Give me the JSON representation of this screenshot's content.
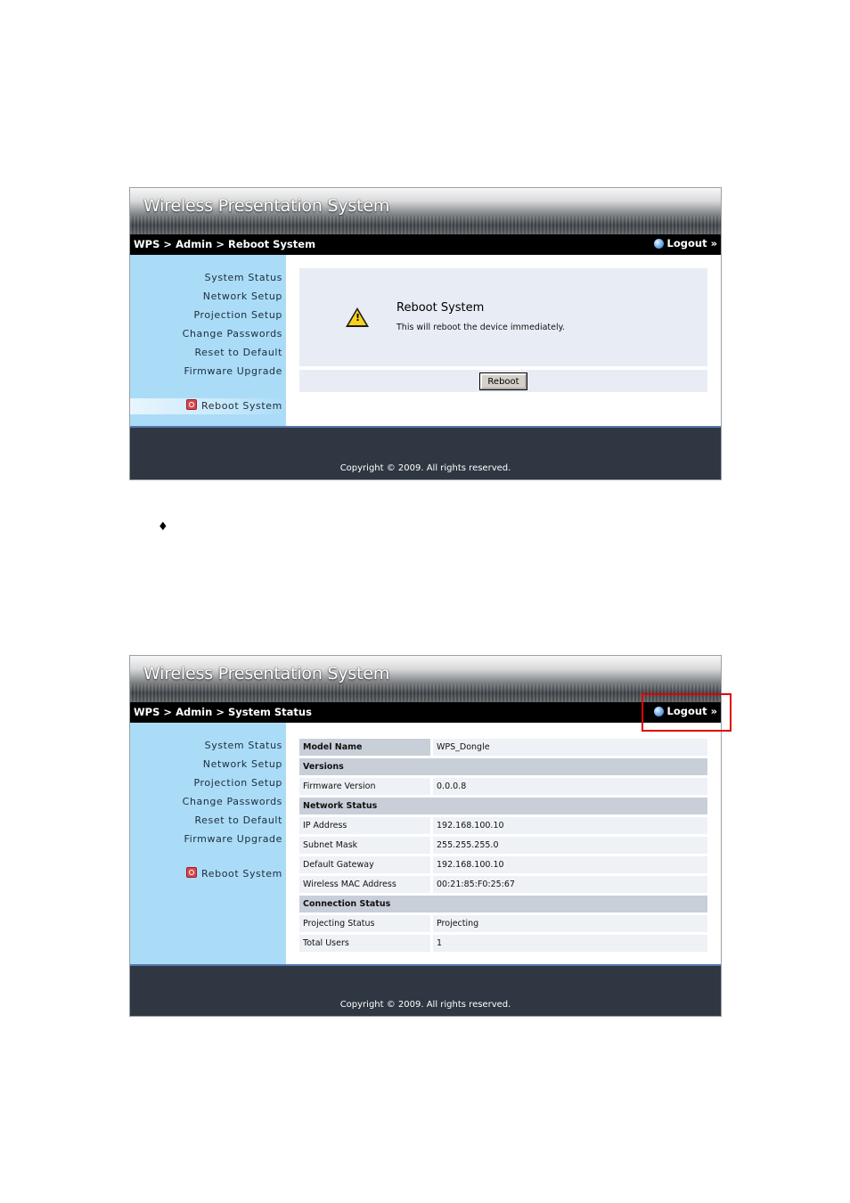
{
  "app": {
    "title": "Wireless Presentation System",
    "logout_label": "Logout »",
    "copyright": "Copyright © 2009. All rights reserved."
  },
  "menu": [
    "System Status",
    "Network Setup",
    "Projection Setup",
    "Change Passwords",
    "Reset to Default",
    "Firmware Upgrade"
  ],
  "reboot_menu_label": "Reboot System",
  "screen1": {
    "breadcrumb": [
      "WPS",
      "Admin",
      "Reboot System"
    ],
    "panel_title": "Reboot System",
    "panel_desc": "This will reboot the device immediately.",
    "button_label": "Reboot"
  },
  "bullet": "♦",
  "screen2": {
    "breadcrumb": [
      "WPS",
      "Admin",
      "System Status"
    ],
    "rows": [
      {
        "type": "model",
        "key": "Model Name",
        "value": "WPS_Dongle"
      },
      {
        "type": "section",
        "key": "Versions"
      },
      {
        "type": "row",
        "key": "Firmware Version",
        "value": "0.0.0.8"
      },
      {
        "type": "section",
        "key": "Network Status"
      },
      {
        "type": "row",
        "key": "IP Address",
        "value": "192.168.100.10"
      },
      {
        "type": "row",
        "key": "Subnet Mask",
        "value": "255.255.255.0"
      },
      {
        "type": "row",
        "key": "Default Gateway",
        "value": "192.168.100.10"
      },
      {
        "type": "row",
        "key": "Wireless MAC Address",
        "value": "00:21:85:F0:25:67"
      },
      {
        "type": "section",
        "key": "Connection Status"
      },
      {
        "type": "row",
        "key": "Projecting Status",
        "value": "Projecting"
      },
      {
        "type": "row",
        "key": "Total Users",
        "value": "1"
      }
    ]
  },
  "colors": {
    "sidebar": "#aadcf8",
    "footer": "#2e3742",
    "highlight": "#e00000"
  }
}
